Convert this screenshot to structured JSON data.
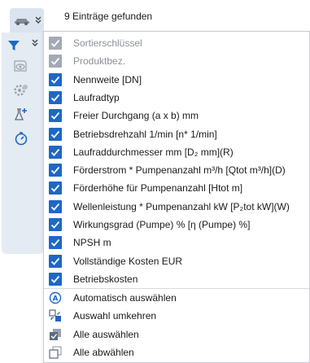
{
  "header": {
    "result_text": "9 Einträge gefunden"
  },
  "colors": {
    "checkbox": "#1e67c6",
    "checkbox_disabled": "#a3aab3",
    "icon_blue": "#1e67c6",
    "icon_grey": "#9aa3ad"
  },
  "sidebar": {
    "icons": [
      "car-icon",
      "chevron-double-down-icon",
      "filter-icon",
      "chevron-double-down-icon",
      "eye-settings-icon",
      "gear-settings-icon",
      "add-flask-icon",
      "stopwatch-icon"
    ]
  },
  "columns": [
    {
      "label": "Sortierschlüssel",
      "checked": true,
      "disabled": true
    },
    {
      "label": "Produktbez.",
      "checked": true,
      "disabled": true
    },
    {
      "label": "Nennweite [DN]",
      "checked": true,
      "disabled": false
    },
    {
      "label": "Laufradtyp",
      "checked": true,
      "disabled": false
    },
    {
      "label": "Freier Durchgang (a x b) mm",
      "checked": true,
      "disabled": false
    },
    {
      "label": "Betriebsdrehzahl 1/min [n* 1/min]",
      "checked": true,
      "disabled": false
    },
    {
      "label": "Laufraddurchmesser mm [D₂ mm](R)",
      "checked": true,
      "disabled": false
    },
    {
      "label": "Förderstrom * Pumpenanzahl m³/h [Qtot m³/h](D)",
      "checked": true,
      "disabled": false
    },
    {
      "label": "Förderhöhe für Pumpenanzahl [Htot m]",
      "checked": true,
      "disabled": false
    },
    {
      "label": "Wellenleistung * Pumpenanzahl kW [P₂tot kW](W)",
      "checked": true,
      "disabled": false
    },
    {
      "label": "Wirkungsgrad (Pumpe) % [η (Pumpe) %]",
      "checked": true,
      "disabled": false
    },
    {
      "label": "NPSH m",
      "checked": true,
      "disabled": false
    },
    {
      "label": "Vollständige Kosten EUR",
      "checked": true,
      "disabled": false
    },
    {
      "label": "Betriebskosten",
      "checked": true,
      "disabled": false
    }
  ],
  "actions": [
    {
      "label": "Automatisch auswählen",
      "icon": "auto-select-icon"
    },
    {
      "label": "Auswahl umkehren",
      "icon": "invert-selection-icon"
    },
    {
      "label": "Alle auswählen",
      "icon": "select-all-icon"
    },
    {
      "label": "Alle abwählen",
      "icon": "deselect-all-icon"
    }
  ]
}
